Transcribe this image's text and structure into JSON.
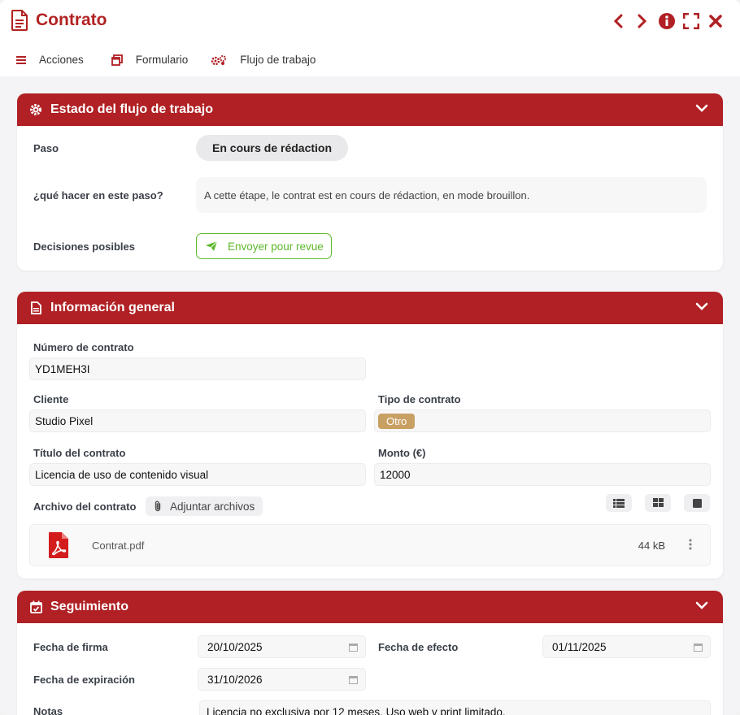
{
  "window": {
    "title": "Contrato"
  },
  "menu": {
    "actions": "Acciones",
    "form": "Formulario",
    "workflow": "Flujo de trabajo"
  },
  "workflow_panel": {
    "header": "Estado del flujo de trabajo",
    "step_label": "Paso",
    "step_value": "En cours de rédaction",
    "what_label": "¿qué hacer en este paso?",
    "what_value": "A cette étape, le contrat est en cours de rédaction, en mode brouillon.",
    "decisions_label": "Decisiones posibles",
    "decision_button": "Envoyer pour revue"
  },
  "general_panel": {
    "header": "Información general",
    "contract_number_label": "Número de contrato",
    "contract_number": "YD1MEH3I",
    "client_label": "Cliente",
    "client": "Studio Pixel",
    "type_label": "Tipo de contrato",
    "type": "Otro",
    "title_label": "Título del contrato",
    "contract_title": "Licencia de uso de contenido visual",
    "amount_label": "Monto (€)",
    "amount": "12000",
    "file_label": "Archivo del contrato",
    "attach_button": "Adjuntar archivos",
    "file": {
      "name": "Contrat.pdf",
      "size": "44 kB"
    }
  },
  "tracking_panel": {
    "header": "Seguimiento",
    "sign_date_label": "Fecha de firma",
    "sign_date": "20/10/2025",
    "effect_date_label": "Fecha de efecto",
    "effect_date": "01/11/2025",
    "expiry_date_label": "Fecha de expiración",
    "expiry_date": "31/10/2026",
    "notes_label": "Notas",
    "notes": "Licencia no exclusiva por 12 meses. Uso web y print limitado."
  },
  "colors": {
    "brand": "#b02024",
    "accent_green": "#5cb82a",
    "badge": "#c9a063"
  }
}
